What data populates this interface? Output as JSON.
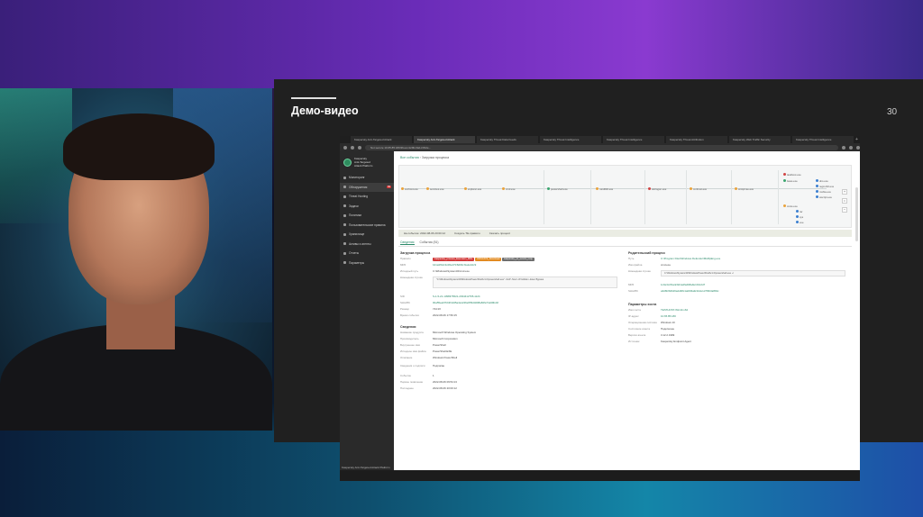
{
  "slide": {
    "title": "Демо-видео",
    "page_number": "30"
  },
  "browser": {
    "tabs": [
      "Kaspersky Anti-Targeted Attack",
      "Kaspersky Anti-Targeted Attack",
      "Kaspersky Threat Data Feeds",
      "Kaspersky Threat Intelligence",
      "Kaspersky Threat Intelligence",
      "Kaspersky Threat Attribution",
      "Kaspersky Web Traffic Security",
      "Kaspersky Threat Intelligence"
    ],
    "url": "Not secure  10.65.85.180/#/events/9bc0a1c3f12e...",
    "new_tab": "+"
  },
  "sidebar": {
    "product": [
      "Kaspersky",
      "Anti-Targeted",
      "Attack Platform"
    ],
    "items": [
      {
        "label": "Мониторинг",
        "badge": ""
      },
      {
        "label": "Обнаружения",
        "badge": "99"
      },
      {
        "label": "Threat Hunting",
        "badge": ""
      },
      {
        "label": "Задачи",
        "badge": ""
      },
      {
        "label": "Политики",
        "badge": ""
      },
      {
        "label": "Пользовательские правила",
        "badge": ""
      },
      {
        "label": "Хранилище",
        "badge": ""
      },
      {
        "label": "Активы и агенты",
        "badge": ""
      },
      {
        "label": "Отчеты",
        "badge": ""
      },
      {
        "label": "Параметры",
        "badge": ""
      }
    ],
    "footer": "Kaspersky Anti-Targeted Attack Platform"
  },
  "main": {
    "breadcrumb": [
      "Все события",
      "Загрузка процесса"
    ],
    "tree_nodes": [
      "svchost.exe",
      "services.exe",
      "explorer.exe",
      "cmd.exe",
      "powershell.exe",
      "rundll32.exe",
      "winlogon.exe",
      "conhost.exe",
      "wmiprvse.exe",
      "taskhost.exe",
      "lsass.exe",
      "csrss.exe"
    ],
    "tree_leaves": [
      "dns.exe",
      "regsvr32.exe",
      "mshta.exe",
      "wscript.exe",
      "rar",
      "sys",
      "exe"
    ],
    "toolbar": [
      "На событие: 2022-08-06 20:00:12",
      "Создать ТЕ-правило",
      "Скачать процесс"
    ],
    "tabs": [
      "Сведения",
      "События (51)"
    ],
    "left_section": {
      "title": "Загрузка процесса",
      "rows": [
        {
          "k": "Правило",
          "v": "",
          "chips": [
            "Kaspersky_process_Execution_MRL",
            "DNSCAT2_Download",
            "kaspersky_ps_events_reqs"
          ]
        },
        {
          "k": "MD5",
          "v": "b41a3fb2c3c28e47fc8d03cf1a2eb2c9"
        },
        {
          "k": "Исходный путь",
          "v": "C:\\Windows\\System32\\cmd.exe"
        },
        {
          "k": "Командная строка",
          "v": "\"C:\\Windows\\System32\\WindowsPowerShell\\v1.0\\powershell.exe\" -NoP -NonI -W Hidden -Exec Bypass"
        },
        {
          "k": "SID",
          "v": "S-1-5-21-1398376521-2034412765-1124"
        },
        {
          "k": "SHA256",
          "v": "0ba55ea07bb3f4d45a4a1226ef8f3d3d98a82fa74e99bd1f"
        },
        {
          "k": "Размер",
          "v": "744 Кб"
        },
        {
          "k": "Время события",
          "v": "2022-08-06 17:56:15"
        }
      ],
      "sub_title": "Сведения",
      "sub_rows": [
        {
          "k": "Название продукта",
          "v": "Microsoft Windows Operating System"
        },
        {
          "k": "Производитель",
          "v": "Microsoft Corporation"
        },
        {
          "k": "Внутреннее имя",
          "v": "PowerShell"
        },
        {
          "k": "Исходное имя файла",
          "v": "PowerShell.EXE"
        },
        {
          "k": "Описание",
          "v": "Windows PowerShell"
        },
        {
          "k": "Сведения о подписи",
          "v": "Подписан"
        },
        {
          "k": "Событие",
          "v": "1"
        },
        {
          "k": "Первое появление",
          "v": "2022-08-06 09:54:13"
        },
        {
          "k": "Последнее",
          "v": "2022-08-06 20:00:12"
        }
      ]
    },
    "right_section": {
      "title": "Родительский процесс",
      "rows": [
        {
          "k": "Путь",
          "v": "C:\\Program Files\\Windows Defender\\MsMpEng.exe"
        },
        {
          "k": "Имя файла",
          "v": "cmd.exe"
        },
        {
          "k": "Командная строка",
          "v": "C:\\Windows\\System32\\WindowsPowerShell\\v1.0\\powershell.exe -c"
        },
        {
          "k": "MD5",
          "v": "1c3e3c2f1a4c9d1a4fa2b8a9e1b3c2d7"
        },
        {
          "k": "SHA256",
          "v": "a3d6f2b0b26a2d48c1ab9f4a9c0c2e1d7f0b3a8b9c"
        }
      ],
      "sub_title": "Параметры хоста",
      "sub_rows": [
        {
          "k": "Имя хоста",
          "v": "TESTHOST-Win10-x64"
        },
        {
          "k": "IP-адрес",
          "v": "10.65.85.180"
        },
        {
          "k": "Операционная система",
          "v": "Windows 10"
        },
        {
          "k": "Состояние агента",
          "v": "Подключен"
        },
        {
          "k": "Версия агента",
          "v": "3.12.2.1999"
        },
        {
          "k": "Источник",
          "v": "Kaspersky Endpoint Agent"
        }
      ]
    }
  }
}
